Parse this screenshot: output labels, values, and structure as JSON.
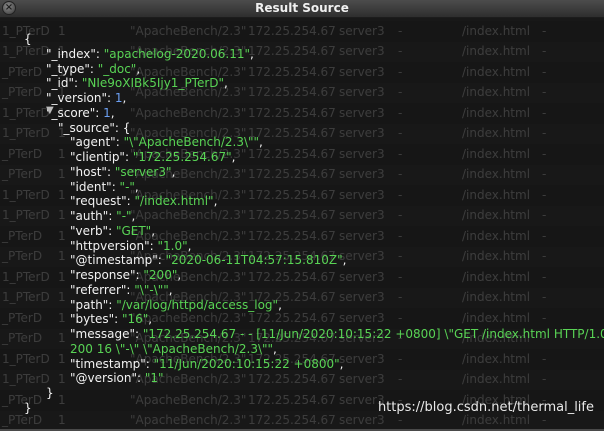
{
  "window": {
    "title": "Result Source"
  },
  "background_rows": {
    "id": "_PTerD",
    "id_partial": "1_PTerD",
    "count": "1",
    "agent": "\"ApacheBench/2.3\"",
    "clientip": "172.25.254.67",
    "host": "server3",
    "dash": "-",
    "request": "/index.html"
  },
  "source": {
    "open_brace": "{",
    "close_brace": "}",
    "top_fields": [
      {
        "key": "\"_index\"",
        "value": "\"apachelog-2020.06.11\"",
        "type": "string"
      },
      {
        "key": "\"_type\"",
        "value": "\"_doc\"",
        "type": "string"
      },
      {
        "key": "\"_id\"",
        "value": "\"NIe9oXIBk5Ijy1_PTerD\"",
        "type": "string"
      },
      {
        "key": "\"_version\"",
        "value": "1",
        "type": "number"
      },
      {
        "key": "\"_score\"",
        "value": "1",
        "type": "number"
      }
    ],
    "source_key": "\"_source\"",
    "source_fields": [
      {
        "key": "\"agent\"",
        "value": "\"\\\"ApacheBench/2.3\\\"\""
      },
      {
        "key": "\"clientip\"",
        "value": "\"172.25.254.67\""
      },
      {
        "key": "\"host\"",
        "value": "\"server3\""
      },
      {
        "key": "\"ident\"",
        "value": "\"-\""
      },
      {
        "key": "\"request\"",
        "value": "\"/index.html\""
      },
      {
        "key": "\"auth\"",
        "value": "\"-\""
      },
      {
        "key": "\"verb\"",
        "value": "\"GET\""
      },
      {
        "key": "\"httpversion\"",
        "value": "\"1.0\""
      },
      {
        "key": "\"@timestamp\"",
        "value": "\"2020-06-11T04:57:15.810Z\""
      },
      {
        "key": "\"response\"",
        "value": "\"200\""
      },
      {
        "key": "\"referrer\"",
        "value": "\"\\\"-\\\"\""
      },
      {
        "key": "\"path\"",
        "value": "\"/var/log/httpd/access_log\""
      },
      {
        "key": "\"bytes\"",
        "value": "\"16\""
      },
      {
        "key": "\"message\"",
        "value": "\"172.25.254.67 - - [11/Jun/2020:10:15:22 +0800] \\\"GET /index.html HTTP/1.0\\\"",
        "continuation": "200 16 \\\"-\\\" \\\"ApacheBench/2.3\\\"\""
      },
      {
        "key": "\"timestamp\"",
        "value": "\"11/Jun/2020:10:15:22 +0800\""
      },
      {
        "key": "\"@version\"",
        "value": "\"1\""
      }
    ],
    "source_close": "}"
  },
  "watermark": "https://blog.csdn.net/thermal_life"
}
